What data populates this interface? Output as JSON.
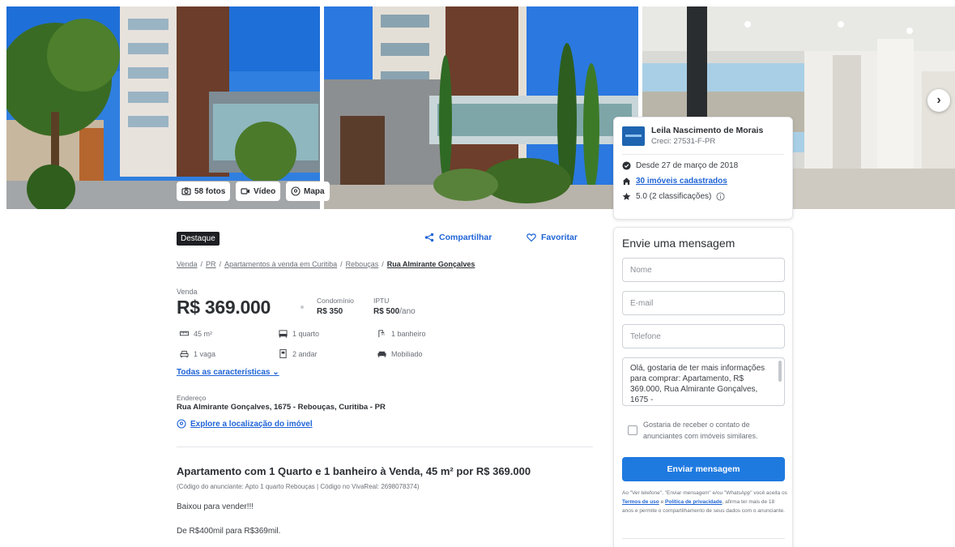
{
  "gallery": {
    "photos_label": "58 fotos",
    "video_label": "Vídeo",
    "map_label": "Mapa"
  },
  "agent": {
    "name": "Leila Nascimento de Morais",
    "creci": "Creci: 27531-F-PR",
    "since": "Desde 27 de março de 2018",
    "listings": "30 imóveis cadastrados",
    "rating": "5.0 (2 classificações)"
  },
  "header": {
    "badge": "Destaque",
    "share": "Compartilhar",
    "favorite": "Favoritar"
  },
  "breadcrumb": [
    "Venda",
    "PR",
    "Apartamentos à venda em Curitiba",
    "Rebouças",
    "Rua Almirante Gonçalves"
  ],
  "price": {
    "label": "Venda",
    "value": "R$ 369.000",
    "condo_label": "Condomínio",
    "condo_value": "R$ 350",
    "iptu_label": "IPTU",
    "iptu_value": "R$ 500",
    "iptu_unit": "/ano"
  },
  "features": {
    "area": "45 m²",
    "rooms": "1 quarto",
    "bath": "1 banheiro",
    "parking": "1 vaga",
    "floor": "2 andar",
    "furnished": "Mobiliado",
    "all_link": "Todas as características"
  },
  "address": {
    "label": "Endereço",
    "value": "Rua Almirante Gonçalves, 1675 - Rebouças, Curitiba - PR",
    "explore": "Explore a localização do imóvel"
  },
  "listing": {
    "title": "Apartamento com 1 Quarto e 1 banheiro à Venda, 45 m² por R$ 369.000",
    "code": "(Código do anunciante: Apto 1 quarto Rebouças | Código no VivaReal: 2698078374)",
    "desc_1": "Baixou para vender!!!",
    "desc_2": "De R$400mil para R$369mil."
  },
  "form": {
    "title": "Envie uma mensagem",
    "name_placeholder": "Nome",
    "email_placeholder": "E-mail",
    "phone_placeholder": "Telefone",
    "message": "Olá, gostaria de ter mais informações para comprar: Apartamento, R$ 369.000, Rua Almirante Gonçalves, 1675 -",
    "checkbox_label": "Gostaria de receber o contato de anunciantes com imóveis similares.",
    "send": "Enviar mensagem",
    "legal_1": "Ao \"Ver telefone\", \"Enviar mensagem\" e/ou \"WhatsApp\" você aceita os",
    "terms": "Termos de uso",
    "legal_2": "e",
    "privacy": "Política de privacidade",
    "legal_3": ", afirma ter mais de 18 anos e permite o compartilhamento de seus dados com o anunciante."
  },
  "colors": {
    "accent": "#1f64d6",
    "button": "#1f7ae0",
    "badge": "#1d1f22"
  },
  "icons": {
    "camera": "camera-icon",
    "video": "video-icon",
    "map": "map-pin-icon",
    "share": "share-icon",
    "heart": "heart-icon",
    "next": "chevron-right-icon"
  }
}
